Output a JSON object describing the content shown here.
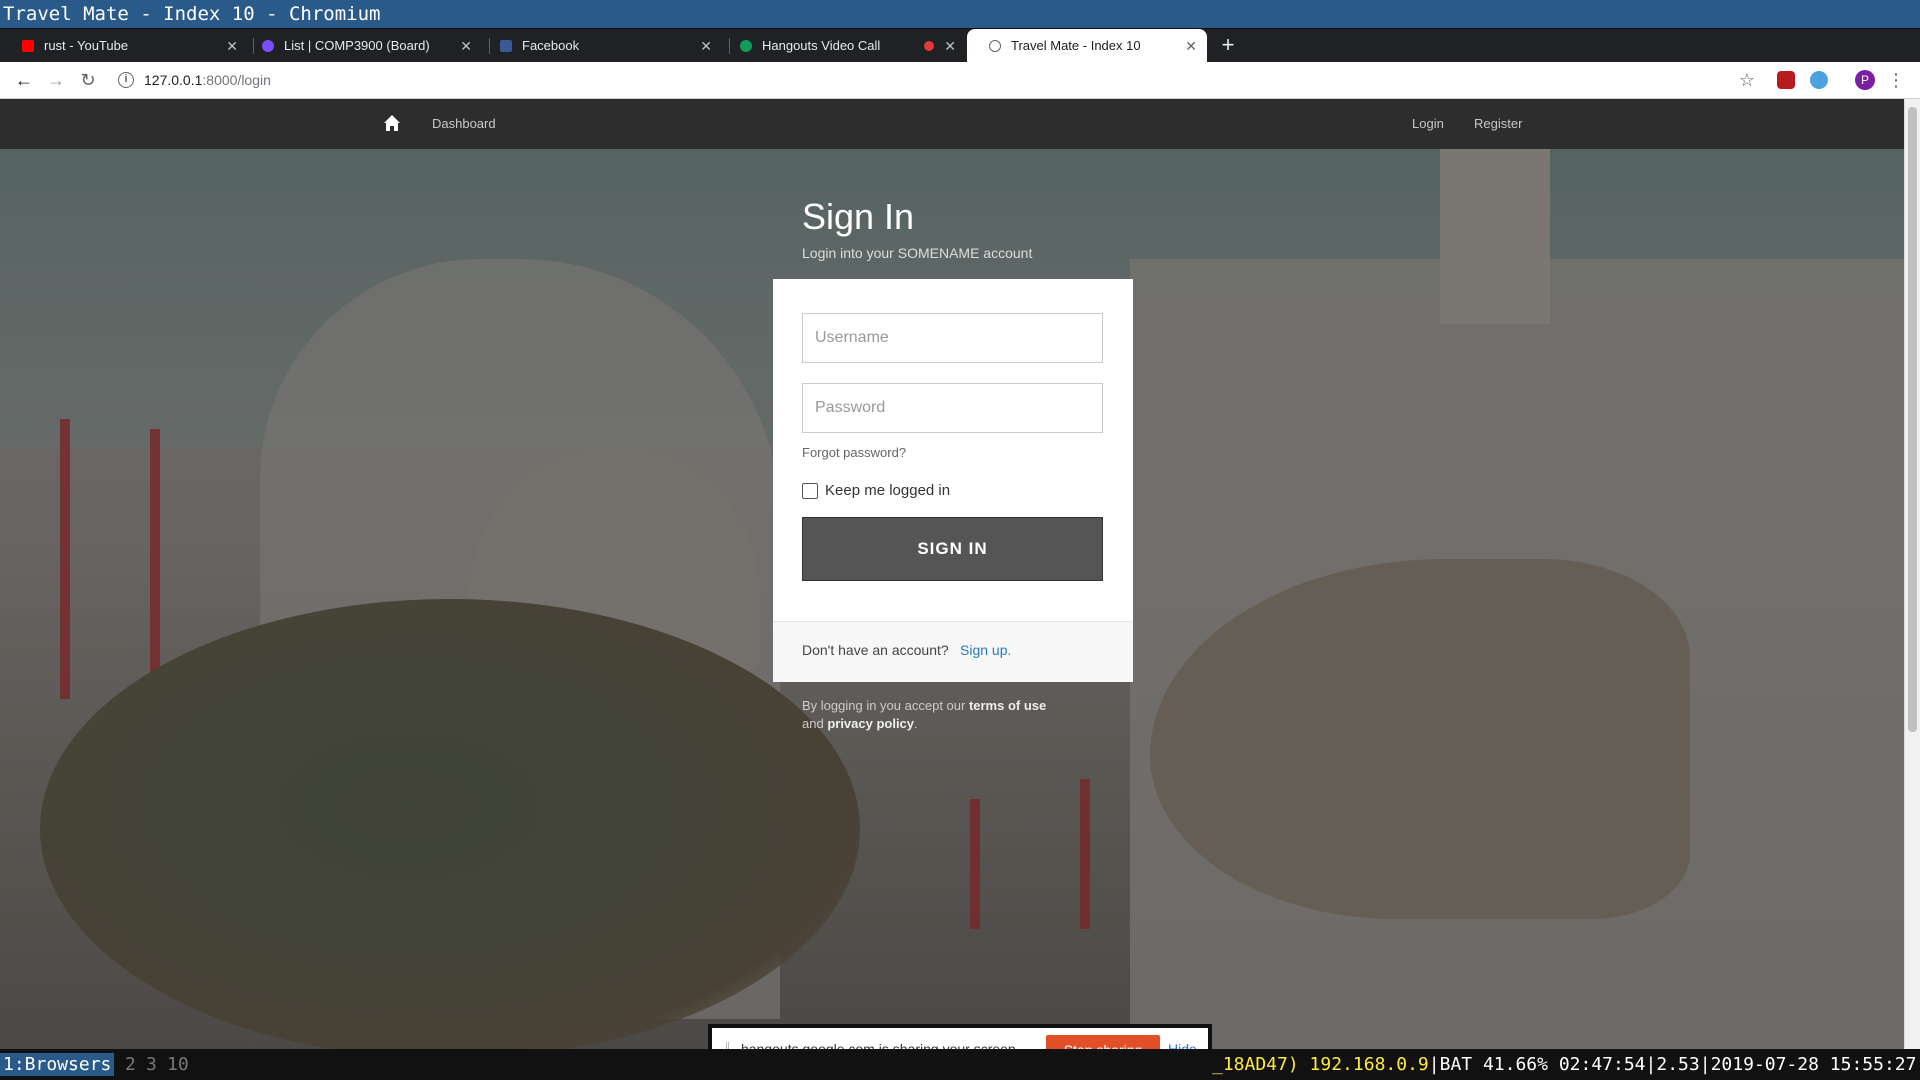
{
  "window": {
    "title": "Travel Mate - Index 10 - Chromium"
  },
  "tabs": [
    {
      "label": "rust - YouTube",
      "icon": "youtube-icon"
    },
    {
      "label": "List | COMP3900 (Board)",
      "icon": "board-icon"
    },
    {
      "label": "Facebook",
      "icon": "facebook-icon"
    },
    {
      "label": "Hangouts Video Call",
      "icon": "hangouts-icon"
    },
    {
      "label": "Travel Mate - Index 10",
      "icon": "globe-icon",
      "active": true
    }
  ],
  "toolbar": {
    "url_host": "127.0.0.1",
    "url_rest": ":8000/login"
  },
  "profile": {
    "initial": "P"
  },
  "nav": {
    "dashboard": "Dashboard",
    "login": "Login",
    "register": "Register"
  },
  "signin": {
    "heading": "Sign In",
    "subheading": "Login into your SOMENAME account",
    "username_placeholder": "Username",
    "password_placeholder": "Password",
    "forgot": "Forgot password?",
    "keep_logged": "Keep me logged in",
    "button": "SIGN IN",
    "no_account": "Don't have an account?",
    "signup": "Sign up.",
    "terms_prefix": "By logging in you accept our ",
    "terms_link": "terms of use",
    "terms_and": "and ",
    "privacy_link": "privacy policy",
    "terms_suffix": "."
  },
  "share": {
    "message": "hangouts.google.com is sharing your screen.",
    "stop": "Stop sharing",
    "hide": "Hide"
  },
  "statusbar": {
    "workspaces": [
      "1:Browsers",
      "2",
      "3",
      "10"
    ],
    "prefix": "_18AD47)",
    "ip": "192.168.0.9",
    "battery": "BAT 41.66% 02:47:54",
    "load": "2.53",
    "datetime": "2019-07-28 15:55:27"
  },
  "colors": {
    "accent": "#2a5a8a",
    "button": "#555555",
    "stop": "#e2502a",
    "link": "#2a7bbf"
  }
}
